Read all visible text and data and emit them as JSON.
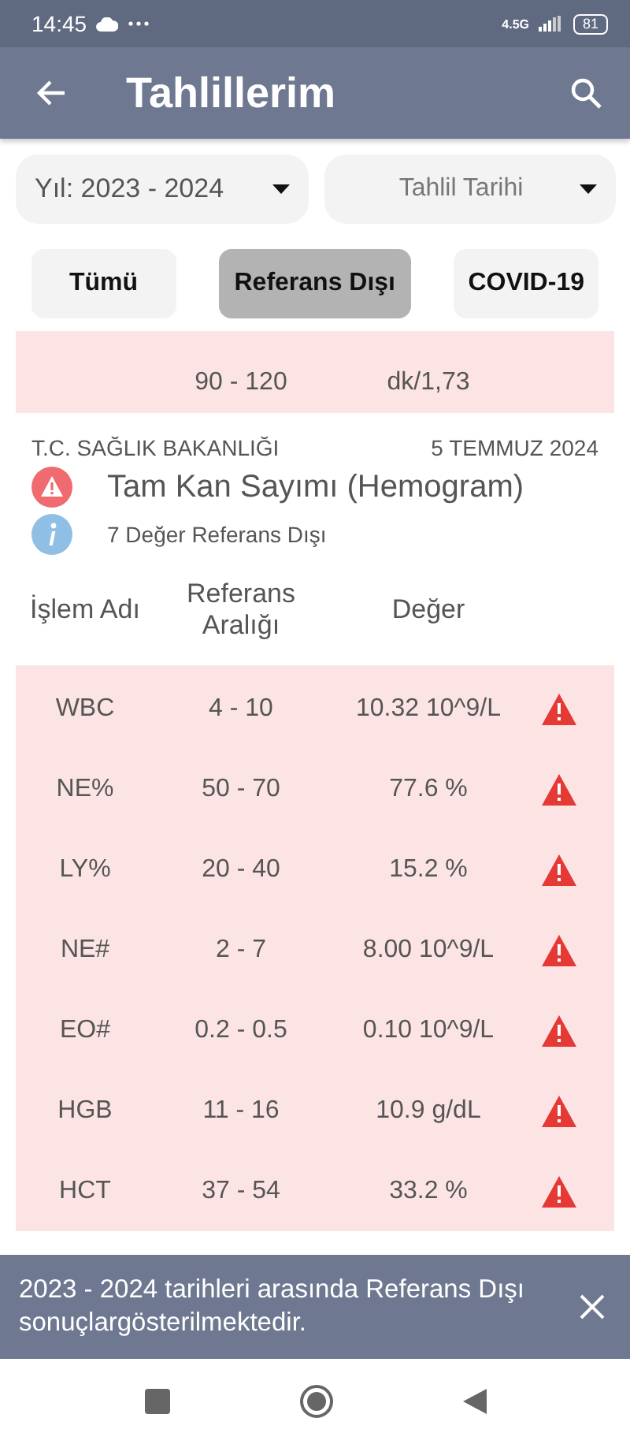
{
  "status_bar": {
    "time": "14:45",
    "battery": "81",
    "network": "4.5G"
  },
  "app_bar": {
    "title": "Tahlillerim"
  },
  "filters": [
    {
      "label": "Yıl: 2023 - 2024",
      "kind": "value"
    },
    {
      "label": "Tahlil Tarihi",
      "kind": "placeholder"
    }
  ],
  "chips": [
    {
      "label": "Tümü",
      "selected": false
    },
    {
      "label": "Referans Dışı",
      "selected": true
    },
    {
      "label": "COVID-19",
      "selected": false
    }
  ],
  "previous_row": {
    "range": "90 - 120",
    "value": "dk/1,73",
    "flagged": true
  },
  "test": {
    "provider": "T.C. SAĞLIK BAKANLIĞI",
    "date": "5 TEMMUZ 2024",
    "name": "Tam Kan Sayımı (Hemogram)",
    "summary": "7 Değer Referans Dışı"
  },
  "table": {
    "columns": [
      "İşlem Adı",
      "Referans Aralığı",
      "Değer"
    ],
    "rows": [
      {
        "name": "WBC",
        "range": "4 - 10",
        "value": "10.32 10^9/L",
        "flagged": true
      },
      {
        "name": "NE%",
        "range": "50 - 70",
        "value": "77.6 %",
        "flagged": true
      },
      {
        "name": "LY%",
        "range": "20 - 40",
        "value": "15.2 %",
        "flagged": true
      },
      {
        "name": "NE#",
        "range": "2 - 7",
        "value": "8.00 10^9/L",
        "flagged": true
      },
      {
        "name": "EO#",
        "range": "0.2 - 0.5",
        "value": "0.10 10^9/L",
        "flagged": true
      },
      {
        "name": "HGB",
        "range": "11 - 16",
        "value": "10.9 g/dL",
        "flagged": true
      },
      {
        "name": "HCT",
        "range": "37 - 54",
        "value": "33.2 %",
        "flagged": true
      }
    ]
  },
  "snackbar": {
    "message": "2023 - 2024 tarihleri arasında Referans Dışı sonuçlargösterilmektedir."
  }
}
